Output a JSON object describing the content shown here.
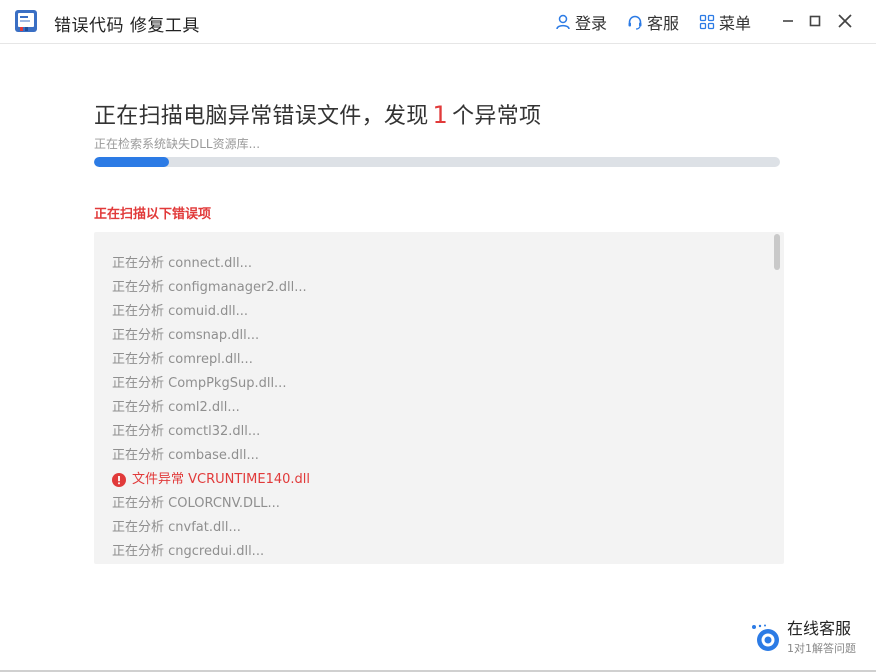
{
  "app": {
    "title": "错误代码 修复工具"
  },
  "header": {
    "login_label": "登录",
    "service_label": "客服",
    "menu_label": "菜单"
  },
  "scan": {
    "heading_prefix": "正在扫描电脑异常错误文件，发现",
    "anomaly_count": "1",
    "heading_suffix": "个异常项",
    "status_text": "正在检索系统缺失DLL资源库...",
    "progress_percent": 11,
    "section_label": "正在扫描以下错误项",
    "items": [
      {
        "text": "正在分析 connect.dll...",
        "status": "normal"
      },
      {
        "text": "正在分析 configmanager2.dll...",
        "status": "normal"
      },
      {
        "text": "正在分析 comuid.dll...",
        "status": "normal"
      },
      {
        "text": "正在分析 comsnap.dll...",
        "status": "normal"
      },
      {
        "text": "正在分析 comrepl.dll...",
        "status": "normal"
      },
      {
        "text": "正在分析 CompPkgSup.dll...",
        "status": "normal"
      },
      {
        "text": "正在分析 coml2.dll...",
        "status": "normal"
      },
      {
        "text": "正在分析 comctl32.dll...",
        "status": "normal"
      },
      {
        "text": "正在分析 combase.dll...",
        "status": "normal"
      },
      {
        "text": "文件异常 VCRUNTIME140.dll",
        "status": "error"
      },
      {
        "text": "正在分析 COLORCNV.DLL...",
        "status": "normal"
      },
      {
        "text": "正在分析 cnvfat.dll...",
        "status": "normal"
      },
      {
        "text": "正在分析 cngcredui.dll...",
        "status": "normal"
      }
    ]
  },
  "support": {
    "title": "在线客服",
    "subtitle": "1对1解答问题"
  },
  "colors": {
    "accent": "#2c7be5",
    "error": "#e13a3a",
    "panel_bg": "#f3f3f3"
  }
}
